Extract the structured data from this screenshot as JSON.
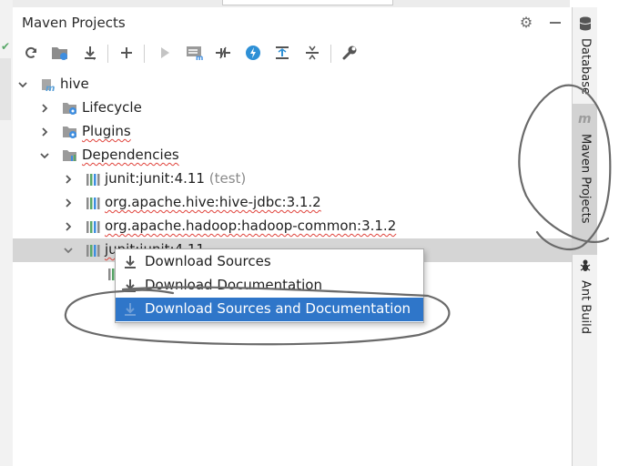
{
  "panel": {
    "title": "Maven Projects"
  },
  "header_icons": [
    "gear-icon",
    "minimize-icon"
  ],
  "toolbar": {
    "buttons": [
      "reimport-icon",
      "generate-sources-icon",
      "download-icon",
      "add-icon",
      "run-icon",
      "execute-goal-icon",
      "toggle-offline-icon",
      "skip-tests-icon",
      "show-dependencies-icon",
      "collapse-all-icon",
      "settings-wrench-icon"
    ]
  },
  "tree": {
    "project": "hive",
    "lifecycle": "Lifecycle",
    "plugins": "Plugins",
    "dependencies": "Dependencies",
    "deps": [
      {
        "name": "junit:junit:4.11",
        "scope": "(test)"
      },
      {
        "name": "org.apache.hive:hive-jdbc:3.1.2",
        "scope": ""
      },
      {
        "name": "org.apache.hadoop:hadoop-common:3.1.2",
        "scope": ""
      }
    ],
    "selected": "junit:junit:4.11"
  },
  "context_menu": {
    "items": [
      "Download Sources",
      "Download Documentation",
      "Download Sources and Documentation"
    ],
    "active_index": 2
  },
  "right_tabs": {
    "database": "Database",
    "maven": "Maven Projects",
    "ant": "Ant Build"
  },
  "colors": {
    "menu_highlight": "#2f76c9",
    "selected_row": "#d5d5d5",
    "maven_icon": "#5aa0d8"
  }
}
